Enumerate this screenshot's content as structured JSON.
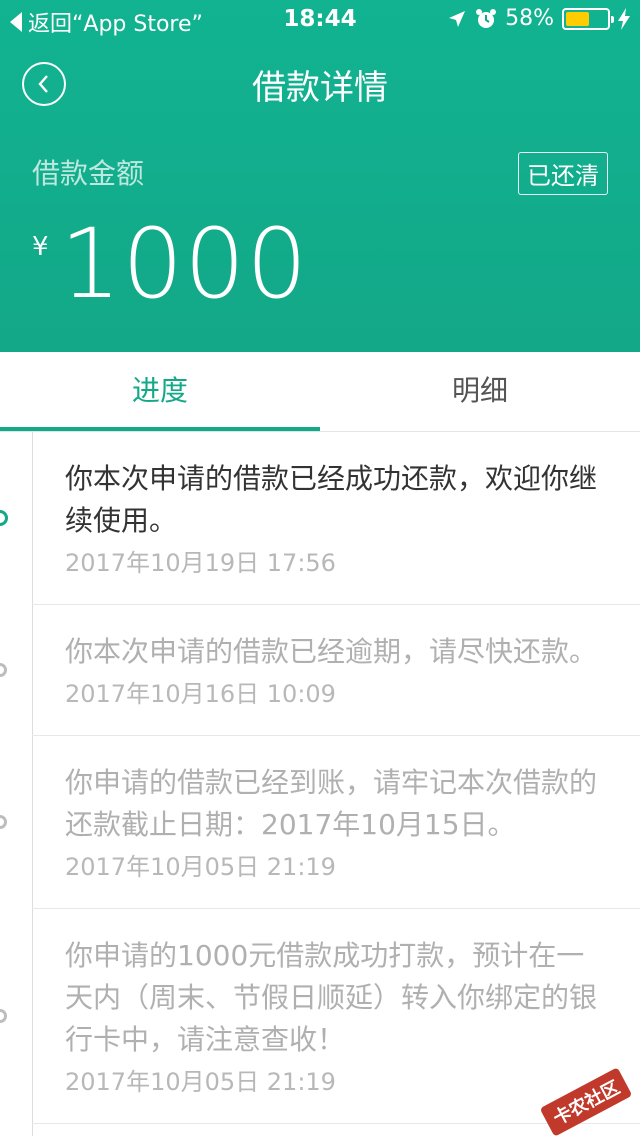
{
  "status_bar": {
    "back_label": "返回“App Store”",
    "time": "18:44",
    "battery": "58%",
    "battery_level": 0.58
  },
  "nav": {
    "title": "借款详情"
  },
  "loan": {
    "amount_label": "借款金额",
    "status": "已还清",
    "currency": "¥",
    "amount": "1000"
  },
  "tabs": [
    {
      "label": "进度"
    },
    {
      "label": "明细"
    }
  ],
  "timeline": [
    {
      "text": "你本次申请的借款已经成功还款，欢迎你继续使用。",
      "time": "2017年10月19日 17:56"
    },
    {
      "text": "你本次申请的借款已经逾期，请尽快还款。",
      "time": "2017年10月16日 10:09"
    },
    {
      "text": "你申请的借款已经到账，请牢记本次借款的还款截止日期：2017年10月15日。",
      "time": "2017年10月05日 21:19"
    },
    {
      "text": "你申请的1000元借款成功打款，预计在一天内（周末、节假日顺延）转入你绑定的银行卡中，请注意查收！",
      "time": "2017年10月05日 21:19"
    }
  ],
  "watermark": "卡农社区",
  "colors": {
    "accent": "#13a888",
    "battery": "#ffcc00"
  }
}
